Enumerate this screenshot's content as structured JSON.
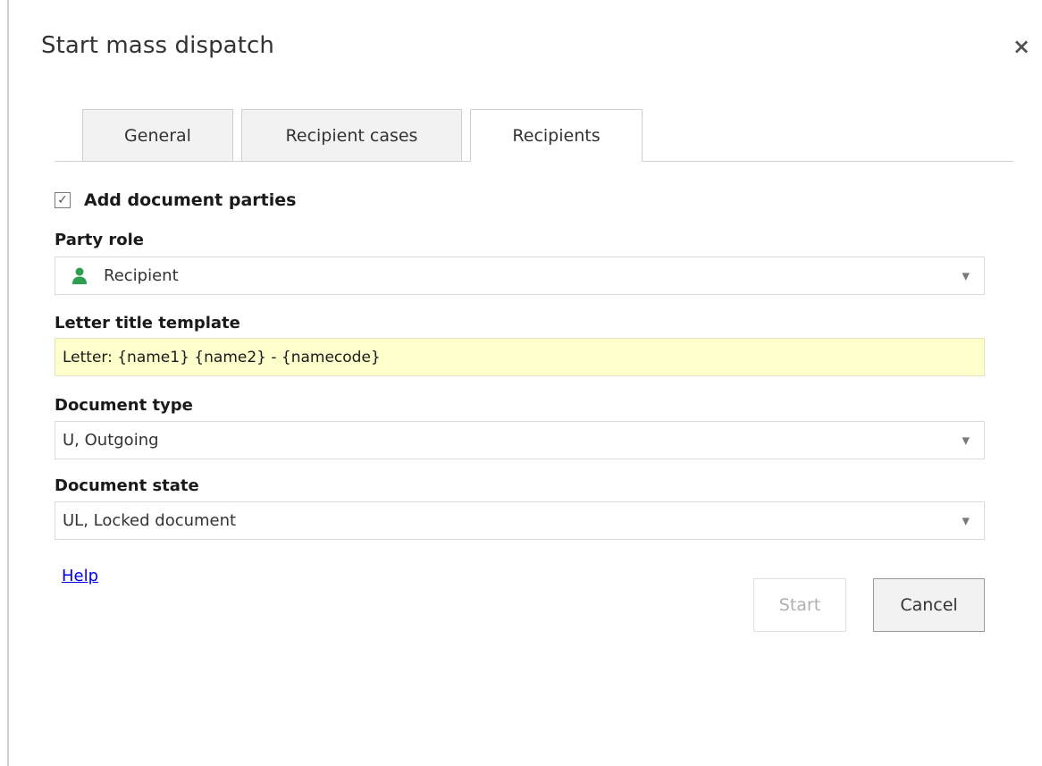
{
  "dialog": {
    "title": "Start mass dispatch",
    "close_symbol": "×"
  },
  "tabs": [
    {
      "label": "General",
      "active": false
    },
    {
      "label": "Recipient cases",
      "active": false
    },
    {
      "label": "Recipients",
      "active": true
    }
  ],
  "add_parties": {
    "label": "Add document parties",
    "checked": true,
    "check_symbol": "✓"
  },
  "party_role": {
    "label": "Party role",
    "value": "Recipient",
    "icon": "person-icon",
    "icon_color": "#2e9e4f"
  },
  "letter_title": {
    "label": "Letter title template",
    "value": "Letter: {name1} {name2} - {namecode}"
  },
  "document_type": {
    "label": "Document type",
    "value": "U, Outgoing"
  },
  "document_state": {
    "label": "Document state",
    "value": "UL, Locked document"
  },
  "dropdown_arrow": "▼",
  "help": {
    "label": "Help"
  },
  "buttons": {
    "start_label": "Start",
    "start_enabled": false,
    "cancel_label": "Cancel"
  }
}
